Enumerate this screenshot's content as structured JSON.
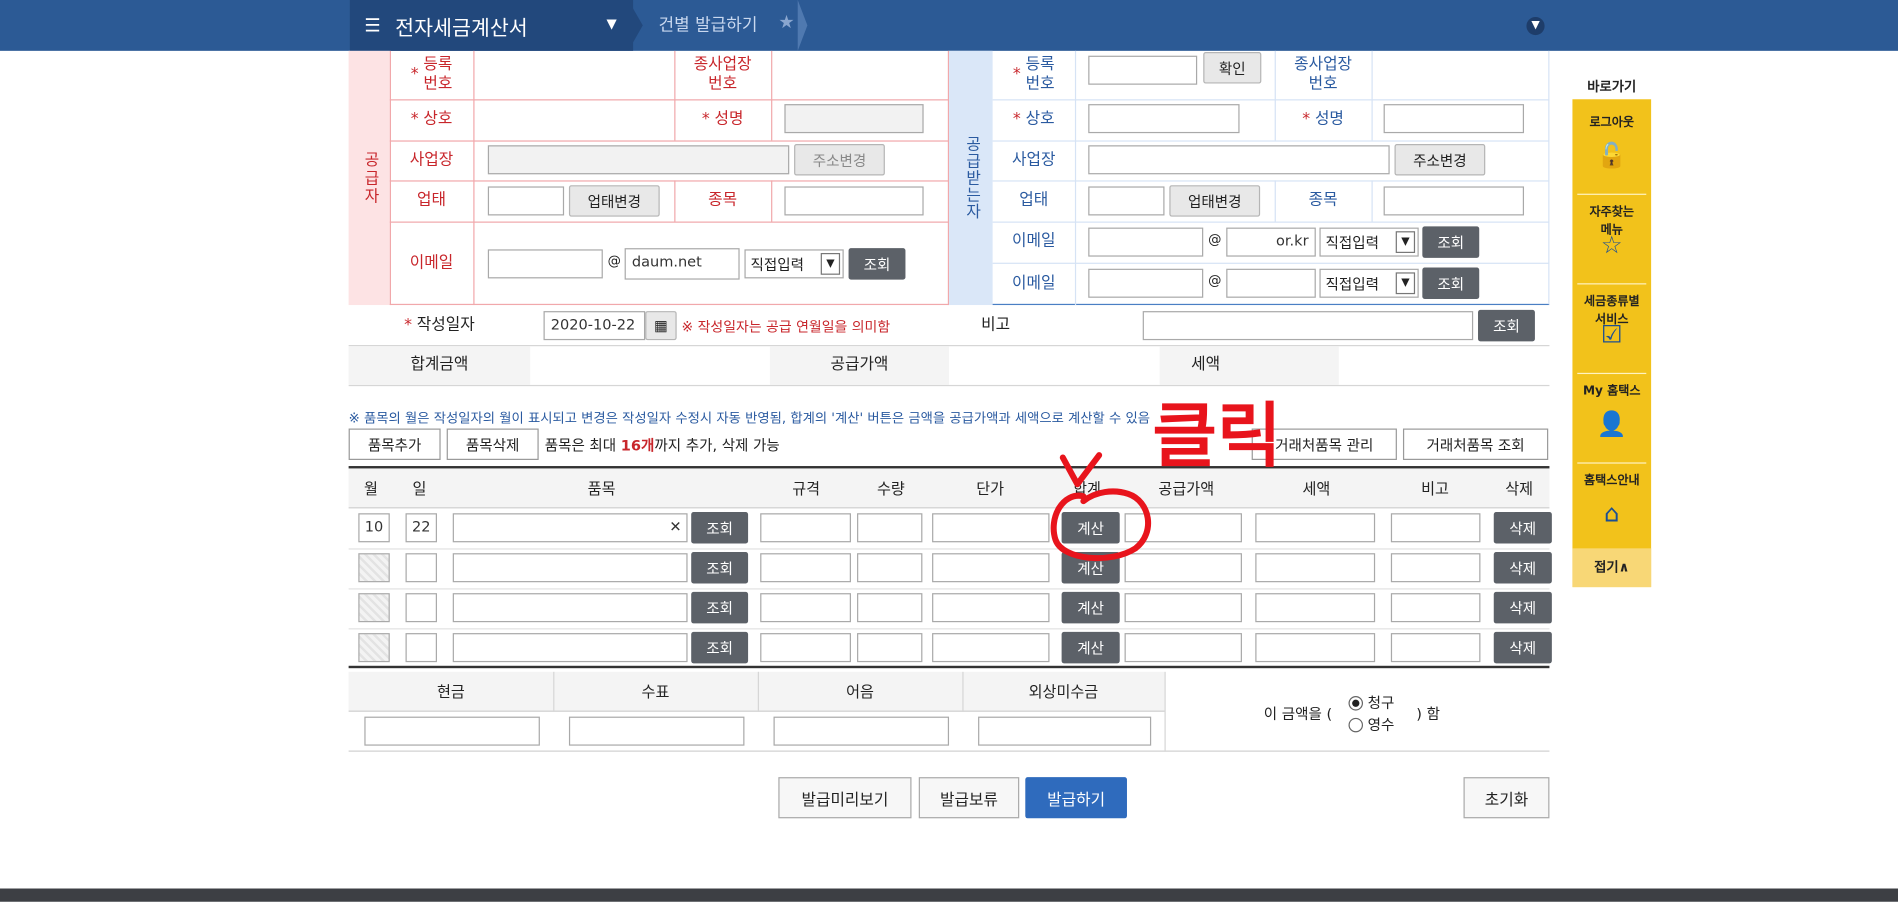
{
  "header": {
    "menu_icon": "hamburger-icon",
    "app_title": "전자세금계산서",
    "breadcrumb": "건별 발급하기",
    "star_icon": "star-icon",
    "expand_icon": "chevron-down-circle-icon"
  },
  "supplier": {
    "side_label": "공급자",
    "reg_no_label": "등록\n번호",
    "reg_no_value": "",
    "sub_biz_label": "종사업장\n번호",
    "company_label": "상호",
    "name_label": "성명",
    "address_label": "사업장",
    "address_change": "주소변경",
    "biz_type_label": "업태",
    "biz_type_change": "업태변경",
    "item_label": "종목",
    "email_label": "이메일",
    "email_domain": "daum.net",
    "email_select": "직접입력",
    "lookup": "조회"
  },
  "buyer": {
    "side_label": "공급받는자",
    "reg_no_label": "등록\n번호",
    "confirm": "확인",
    "sub_biz_label": "종사업장\n번호",
    "company_label": "상호",
    "name_label": "성명",
    "address_label": "사업장",
    "address_change": "주소변경",
    "biz_type_label": "업태",
    "biz_type_change": "업태변경",
    "item_label": "종목",
    "email_label": "이메일",
    "email_domain": "or.kr",
    "email_select": "직접입력",
    "email2_label": "이메일",
    "email2_select": "직접입력",
    "lookup": "조회"
  },
  "date_row": {
    "label": "작성일자",
    "value": "2020-10-22",
    "note": "※ 작성일자는 공급 연월일을 의미함",
    "remark_label": "비고",
    "lookup": "조회"
  },
  "totals_row": {
    "total_label": "합계금액",
    "supply_label": "공급가액",
    "tax_label": "세액"
  },
  "notice": "※ 품목의 월은 작성일자의 월이 표시되고 변경은 작성일자 수정시 자동 반영됨, 합계의 '계산' 버튼은 금액을 공급가액과 세액으로 계산할 수 있음",
  "item_toolbar": {
    "add": "품목추가",
    "delete": "품목삭제",
    "limit_prefix": "품목은 최대",
    "limit_count": "16개",
    "limit_suffix": "까지 추가, 삭제 가능",
    "manage": "거래처품목 관리",
    "lookup": "거래처품목 조회"
  },
  "item_table": {
    "headers": [
      "월",
      "일",
      "품목",
      "규격",
      "수량",
      "단가",
      "합계",
      "공급가액",
      "세액",
      "비고",
      "삭제"
    ],
    "rows": [
      {
        "month": "10",
        "day": "22",
        "item": "",
        "lookup": "조회",
        "calc": "계산",
        "delete": "삭제"
      },
      {
        "month": "",
        "day": "",
        "item": "",
        "lookup": "조회",
        "calc": "계산",
        "delete": "삭제"
      },
      {
        "month": "",
        "day": "",
        "item": "",
        "lookup": "조회",
        "calc": "계산",
        "delete": "삭제"
      },
      {
        "month": "",
        "day": "",
        "item": "",
        "lookup": "조회",
        "calc": "계산",
        "delete": "삭제"
      }
    ]
  },
  "payment": {
    "headers": [
      "현금",
      "수표",
      "어음",
      "외상미수금"
    ],
    "amount_prefix": "이 금액을 (",
    "amount_suffix": ") 함",
    "option_claim": "청구",
    "option_receipt": "영수",
    "selected": "청구"
  },
  "actions": {
    "preview": "발급미리보기",
    "hold": "발급보류",
    "issue": "발급하기",
    "reset": "초기화"
  },
  "annotation": {
    "text": "클릭",
    "color": "#e8141c"
  },
  "quick_menu": {
    "title": "바로가기",
    "items": [
      {
        "label": "로그아웃",
        "icon": "unlock-icon"
      },
      {
        "label": "자주찾는\n메뉴",
        "icon": "star-outline-icon"
      },
      {
        "label": "세금종류별\n서비스",
        "icon": "checkbox-icon"
      },
      {
        "label": "My 홈택스",
        "icon": "user-icon"
      },
      {
        "label": "홈택스안내",
        "icon": "home-icon"
      }
    ],
    "fold": "접기∧"
  },
  "colors": {
    "header_bg": "#2c5a95",
    "supplier_side": "#fde3e4",
    "buyer_side": "#dae7f8",
    "quick_menu": "#f2c21b",
    "primary_button": "#2f6bbd"
  }
}
